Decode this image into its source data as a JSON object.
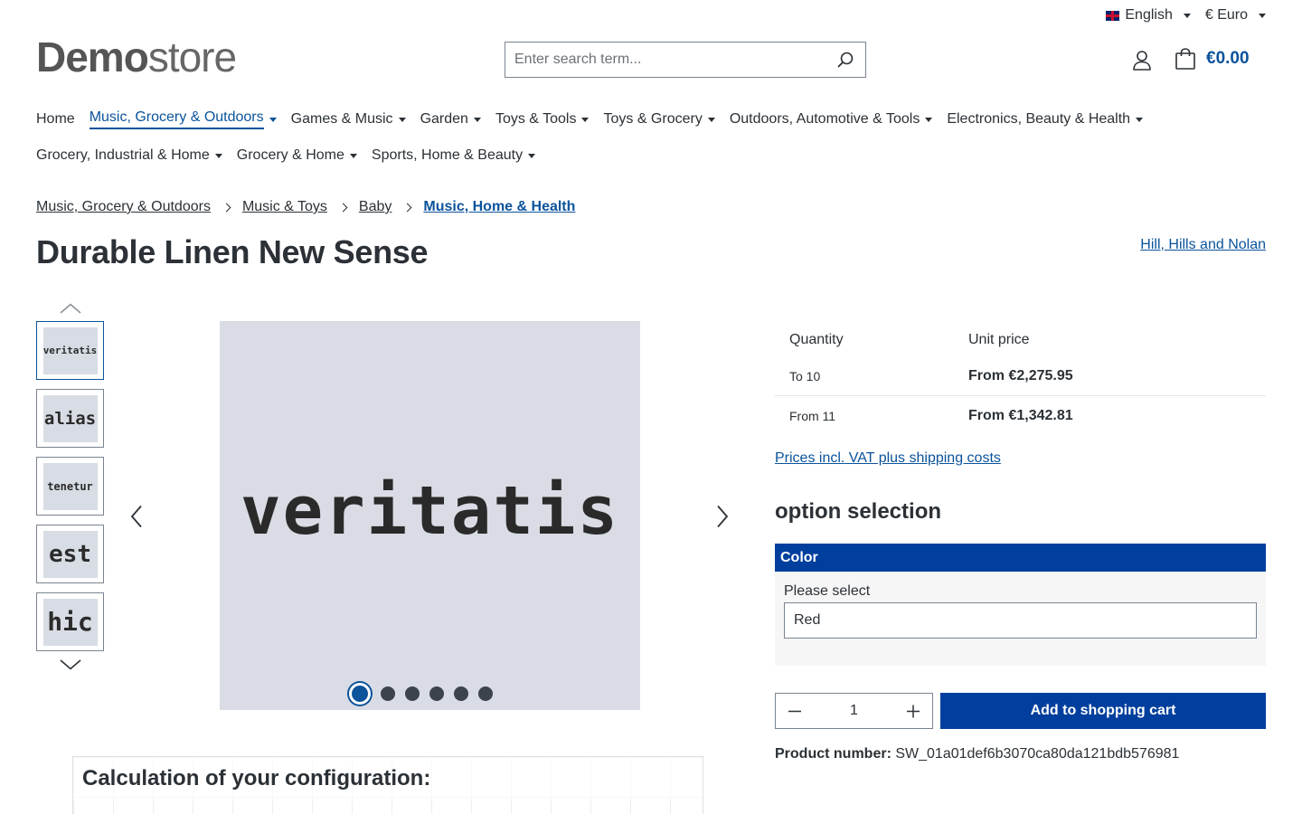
{
  "topbar": {
    "language": "English",
    "currency": "€ Euro"
  },
  "header": {
    "logo_bold": "Demo",
    "logo_light": "store",
    "search_placeholder": "Enter search term...",
    "cart_total": "€0.00"
  },
  "nav": {
    "items": [
      {
        "label": "Home"
      },
      {
        "label": "Music, Grocery & Outdoors"
      },
      {
        "label": "Games & Music"
      },
      {
        "label": "Garden"
      },
      {
        "label": "Toys & Tools"
      },
      {
        "label": "Toys & Grocery"
      },
      {
        "label": "Outdoors, Automotive & Tools"
      },
      {
        "label": "Electronics, Beauty & Health"
      },
      {
        "label": "Grocery, Industrial & Home"
      },
      {
        "label": "Grocery & Home"
      },
      {
        "label": "Sports, Home & Beauty"
      }
    ]
  },
  "breadcrumb": [
    "Music, Grocery & Outdoors",
    "Music & Toys",
    "Baby",
    "Music, Home & Health"
  ],
  "product": {
    "title": "Durable Linen New Sense",
    "manufacturer": "Hill, Hills and Nolan",
    "main_image_text": "veritatis",
    "thumbnails": [
      "veritatis",
      "alias",
      "tenetur",
      "est",
      "hic"
    ]
  },
  "calculation": {
    "title": "Calculation of your configuration:"
  },
  "prices": {
    "col_quantity": "Quantity",
    "col_unit_price": "Unit price",
    "rows": [
      {
        "qty": "To 10",
        "price": "From €2,275.95"
      },
      {
        "qty": "From 11",
        "price": "From €1,342.81"
      }
    ],
    "vat_link": "Prices incl. VAT plus shipping costs"
  },
  "options": {
    "title": "option selection",
    "group": "Color",
    "label": "Please select",
    "selected": "Red"
  },
  "buy": {
    "quantity": "1",
    "add_to_cart": "Add to shopping cart",
    "product_number_label": "Product number:",
    "product_number": "SW_01a01def6b3070ca80da121bdb576981"
  },
  "colors": {
    "primary": "#0b539b",
    "button": "#003f9e"
  }
}
